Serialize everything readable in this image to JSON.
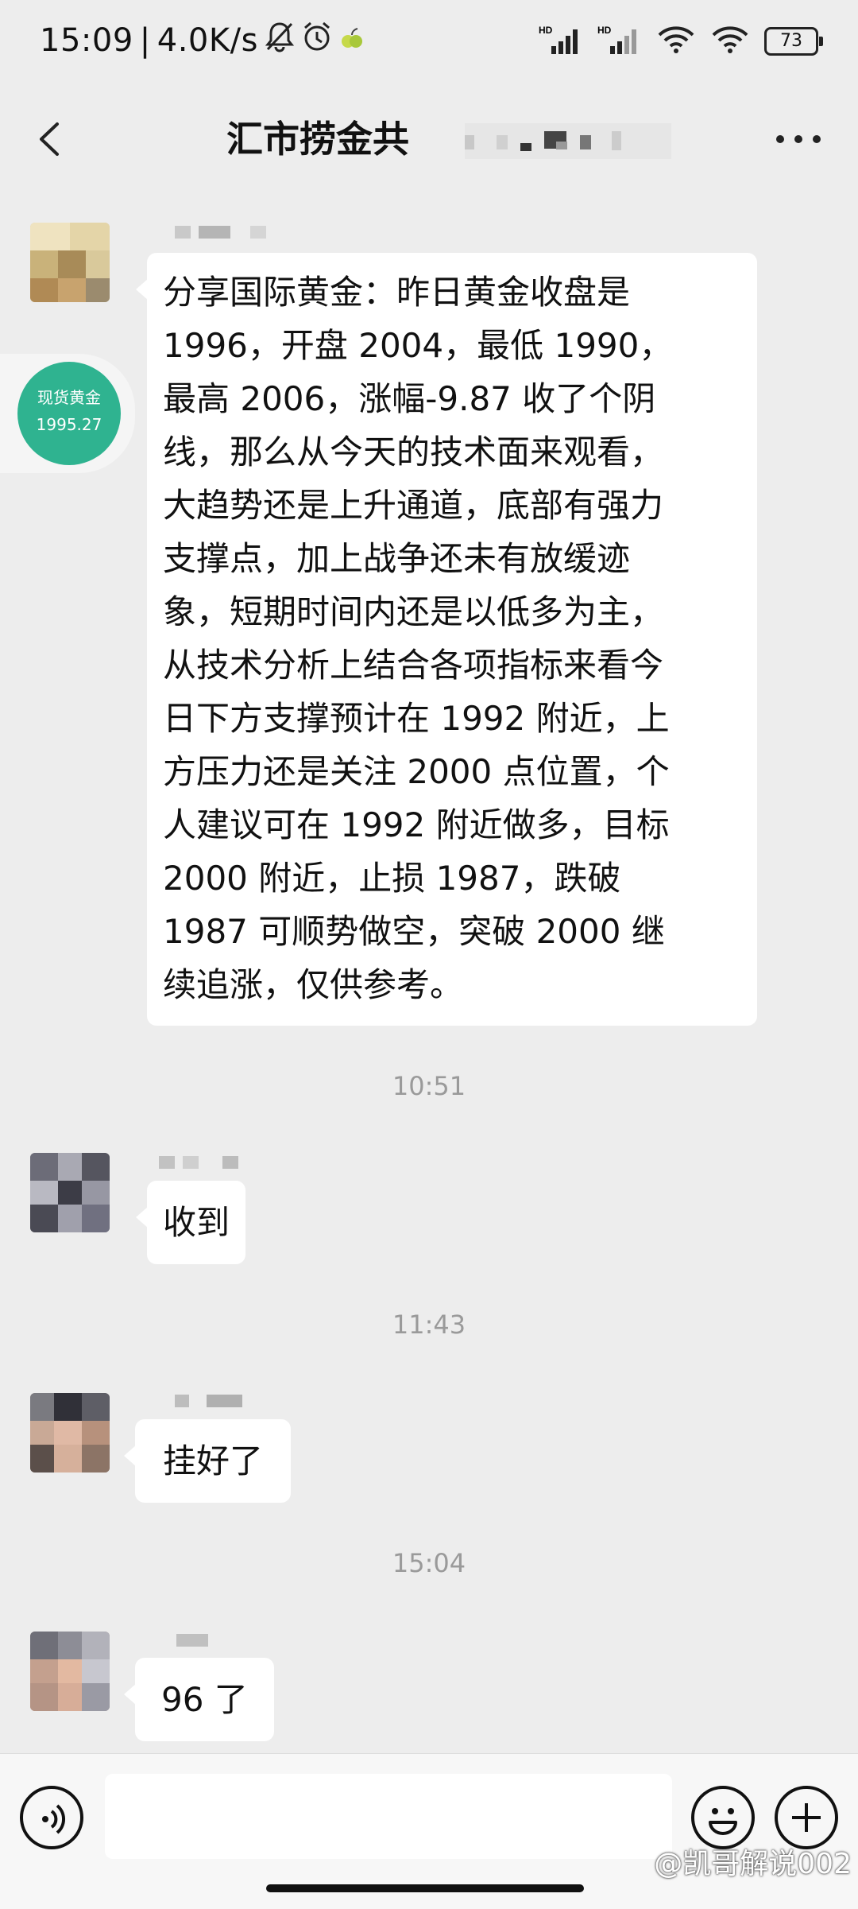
{
  "status_bar": {
    "time": "15:09",
    "network_speed": "4.0K/s",
    "battery": "73",
    "icons": [
      "mute-bell-icon",
      "alarm-icon",
      "app-notification-icon",
      "hd-signal-icon",
      "hd-signal-icon",
      "wifi-icon",
      "wifi-icon",
      "battery-icon"
    ]
  },
  "header": {
    "title": "汇市捞金共\u0000",
    "back_icon": "chevron-left-icon",
    "more_icon": "more-dots-icon"
  },
  "floating_widget": {
    "label": "现货黄金",
    "value": "1995.27",
    "color": "#2fb390"
  },
  "messages": [
    {
      "type": "text",
      "text": "分享国际黄金：昨日黄金收盘是\n1996，开盘 2004，最低 1990，\n最高 2006，涨幅-9.87 收了个阴\n线，那么从今天的技术面来观看，\n大趋势还是上升通道，底部有强力\n支撑点，加上战争还未有放缓迹\n象，短期时间内还是以低多为主，\n从技术分析上结合各项指标来看今\n日下方支撑预计在 1992 附近，上\n方压力还是关注 2000 点位置，个\n人建议可在 1992 附近做多，目标\n2000 附近，止损 1987，跌破\n1987 可顺势做空，突破 2000 继\n续追涨，仅供参考。"
    },
    {
      "type": "time",
      "text": "10:51"
    },
    {
      "type": "text",
      "text": "收到"
    },
    {
      "type": "time",
      "text": "11:43"
    },
    {
      "type": "text",
      "text": "挂好了"
    },
    {
      "type": "time",
      "text": "15:04"
    },
    {
      "type": "text",
      "text": "96 了"
    }
  ],
  "input_bar": {
    "voice_icon": "voice-icon",
    "emoji_icon": "emoji-icon",
    "plus_icon": "plus-icon",
    "placeholder": ""
  },
  "watermark": "@凯哥解说002",
  "colors": {
    "background": "#ededed",
    "bubble": "#ffffff",
    "accent_green": "#2fb390"
  }
}
